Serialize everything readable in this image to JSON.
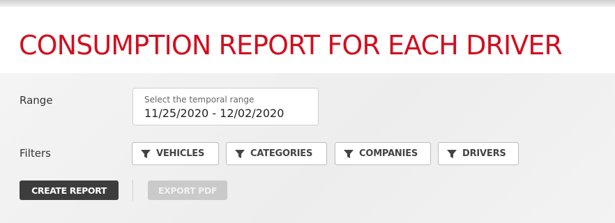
{
  "header": {
    "title": "CONSUMPTION REPORT FOR EACH DRIVER"
  },
  "range": {
    "label": "Range",
    "placeholder": "Select the temporal range",
    "value": "11/25/2020 - 12/02/2020"
  },
  "filters": {
    "label": "Filters",
    "items": [
      {
        "label": "VEHICLES",
        "icon": "funnel-icon"
      },
      {
        "label": "CATEGORIES",
        "icon": "funnel-icon"
      },
      {
        "label": "COMPANIES",
        "icon": "funnel-icon"
      },
      {
        "label": "DRIVERS",
        "icon": "funnel-icon"
      }
    ]
  },
  "actions": {
    "create_label": "CREATE REPORT",
    "export_label": "EXPORT PDF",
    "export_enabled": false
  },
  "colors": {
    "title": "#d10f1f",
    "create_button": "#3d3d3d",
    "export_button_disabled": "#cacaca"
  }
}
